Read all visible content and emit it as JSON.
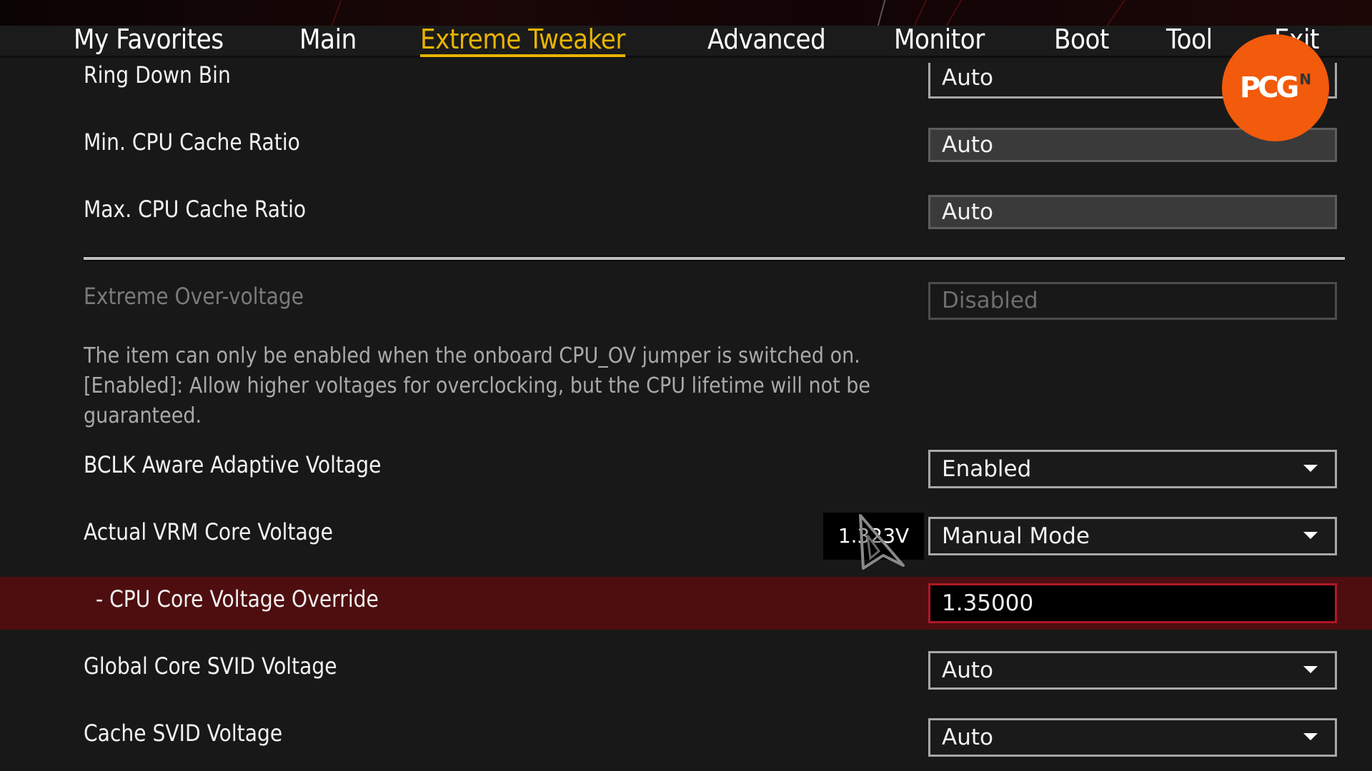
{
  "nav": {
    "tabs": [
      {
        "label": "My Favorites",
        "active": false
      },
      {
        "label": "Main",
        "active": false
      },
      {
        "label": "Extreme Tweaker",
        "active": true
      },
      {
        "label": "Advanced",
        "active": false
      },
      {
        "label": "Monitor",
        "active": false
      },
      {
        "label": "Boot",
        "active": false
      },
      {
        "label": "Tool",
        "active": false
      },
      {
        "label": "Exit",
        "active": false
      }
    ]
  },
  "settings": {
    "ring_down_bin": {
      "label": "Ring Down Bin",
      "value": "Auto"
    },
    "min_cpu_cache_ratio": {
      "label": "Min. CPU Cache Ratio",
      "value": "Auto"
    },
    "max_cpu_cache_ratio": {
      "label": "Max. CPU Cache Ratio",
      "value": "Auto"
    },
    "extreme_over_voltage": {
      "label": "Extreme Over-voltage",
      "value": "Disabled"
    },
    "description": {
      "line1": "The item can only be enabled when the onboard CPU_OV jumper is switched on.",
      "line2": "[Enabled]: Allow higher voltages for overclocking, but the CPU lifetime will not be",
      "line3": "guaranteed."
    },
    "bclk_aware_adaptive_voltage": {
      "label": "BCLK Aware Adaptive Voltage",
      "value": "Enabled"
    },
    "actual_vrm_core_voltage": {
      "label": "Actual VRM Core Voltage",
      "value": "Manual Mode",
      "readout": "1.323V"
    },
    "cpu_core_voltage_override": {
      "label": "- CPU Core Voltage Override",
      "value": "1.35000"
    },
    "global_core_svid_voltage": {
      "label": "Global Core SVID Voltage",
      "value": "Auto"
    },
    "cache_svid_voltage": {
      "label": "Cache SVID Voltage",
      "value": "Auto"
    }
  },
  "watermark": {
    "text": "PCG",
    "superscript": "N"
  },
  "colors": {
    "accent": "#e8b400",
    "highlight_row": "#4e0e10",
    "input_border": "#b01828",
    "logo": "#f25a0c"
  }
}
